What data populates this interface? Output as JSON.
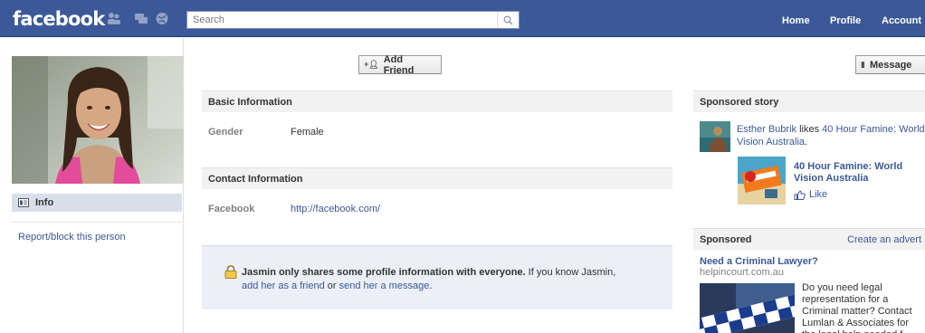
{
  "header": {
    "logo": "facebook",
    "search_placeholder": "Search",
    "nav": [
      "Home",
      "Profile",
      "Account"
    ]
  },
  "left": {
    "info_label": "Info",
    "report_link": "Report/block this person"
  },
  "actions": {
    "add_friend": "Add Friend",
    "message": "Message"
  },
  "basic": {
    "title": "Basic Information",
    "gender_label": "Gender",
    "gender_value": "Female"
  },
  "contact": {
    "title": "Contact Information",
    "facebook_label": "Facebook",
    "facebook_value": "http://facebook.com/"
  },
  "privacy": {
    "bold": "Jasmin only shares some profile information with everyone.",
    "text1": "If you know Jasmin,",
    "link1": "add her as a friend",
    "text2": "or",
    "link2": "send her a message",
    "text3": "."
  },
  "sponsored_story": {
    "title": "Sponsored story",
    "person": "Esther Bubrik",
    "verb": "likes",
    "page_link": "40 Hour Famine: World Vision Australia",
    "period": ".",
    "page_name": "40 Hour Famine: World Vision Australia",
    "like": "Like"
  },
  "sponsored": {
    "title": "Sponsored",
    "create": "Create an advert",
    "ad_title": "Need a Criminal Lawyer?",
    "ad_domain": "helpincourt.com.au",
    "ad_body": "Do you need legal representation for a Criminal matter? Contact Lumlan & Associates for the legal help needed f..."
  },
  "colors": {
    "brand": "#3b5998",
    "panel": "#eceff5",
    "section_head": "#f2f2f2"
  },
  "icons": [
    "friends-icon",
    "messages-icon",
    "notifications-icon",
    "search-icon",
    "info-icon",
    "add-friend-icon",
    "message-icon",
    "lock-icon",
    "thumbs-up-icon"
  ]
}
